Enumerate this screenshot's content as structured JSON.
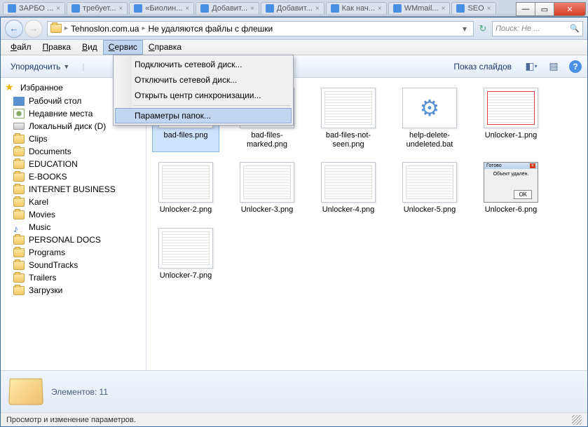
{
  "browserTabs": [
    {
      "label": "ЗАРБО ..."
    },
    {
      "label": "требует..."
    },
    {
      "label": "«Биолин..."
    },
    {
      "label": "Добавит..."
    },
    {
      "label": "Добавит..."
    },
    {
      "label": "Как нач..."
    },
    {
      "label": "WMmail..."
    },
    {
      "label": "SEO"
    }
  ],
  "address": {
    "crumb1": "Tehnoslon.com.ua",
    "crumb2": "Не удаляются файлы с флешки"
  },
  "search": {
    "placeholder": "Поиск: Не ..."
  },
  "menu": {
    "file": "Файл",
    "edit": "Правка",
    "view": "Вид",
    "tools": "Сервис",
    "help": "Справка"
  },
  "toolsMenu": {
    "mapDrive": "Подключить сетевой диск...",
    "disconnectDrive": "Отключить сетевой диск...",
    "syncCenter": "Открыть центр синхронизации...",
    "folderOptions": "Параметры папок..."
  },
  "cmd": {
    "organize": "Упорядочить",
    "slideshow": "Показ слайдов"
  },
  "tree": {
    "favorites": "Избранное",
    "desktop": "Рабочий стол",
    "recent": "Недавние места",
    "localD": "Локальный диск (D)",
    "clips": "Clips",
    "documents": "Documents",
    "education": "EDUCATION",
    "ebooks": "E-BOOKS",
    "ibusiness": "INTERNET BUSINESS",
    "karel": "Karel",
    "movies": "Movies",
    "music": "Music",
    "pdocs": "PERSONAL DOCS",
    "programs": "Programs",
    "soundtracks": "SoundTracks",
    "trailers": "Trailers",
    "downloads": "Загрузки"
  },
  "files": [
    {
      "label": "bad-files.png",
      "kind": "doc",
      "sel": true
    },
    {
      "label": "bad-files-marked.png",
      "kind": "doc-red"
    },
    {
      "label": "bad-files-not-seen.png",
      "kind": "doc"
    },
    {
      "label": "help-delete-undeleted.bat",
      "kind": "gear"
    },
    {
      "label": "Unlocker-1.png",
      "kind": "doc-red"
    },
    {
      "label": "Unlocker-2.png",
      "kind": "doc"
    },
    {
      "label": "Unlocker-3.png",
      "kind": "doc"
    },
    {
      "label": "Unlocker-4.png",
      "kind": "doc"
    },
    {
      "label": "Unlocker-5.png",
      "kind": "doc"
    },
    {
      "label": "Unlocker-6.png",
      "kind": "dlg",
      "dlgTitle": "Готово",
      "dlgText": "Объект удалён.",
      "dlgBtn": "OK"
    },
    {
      "label": "Unlocker-7.png",
      "kind": "doc"
    }
  ],
  "details": {
    "count": "Элементов: 11"
  },
  "status": {
    "text": "Просмотр и изменение параметров."
  }
}
